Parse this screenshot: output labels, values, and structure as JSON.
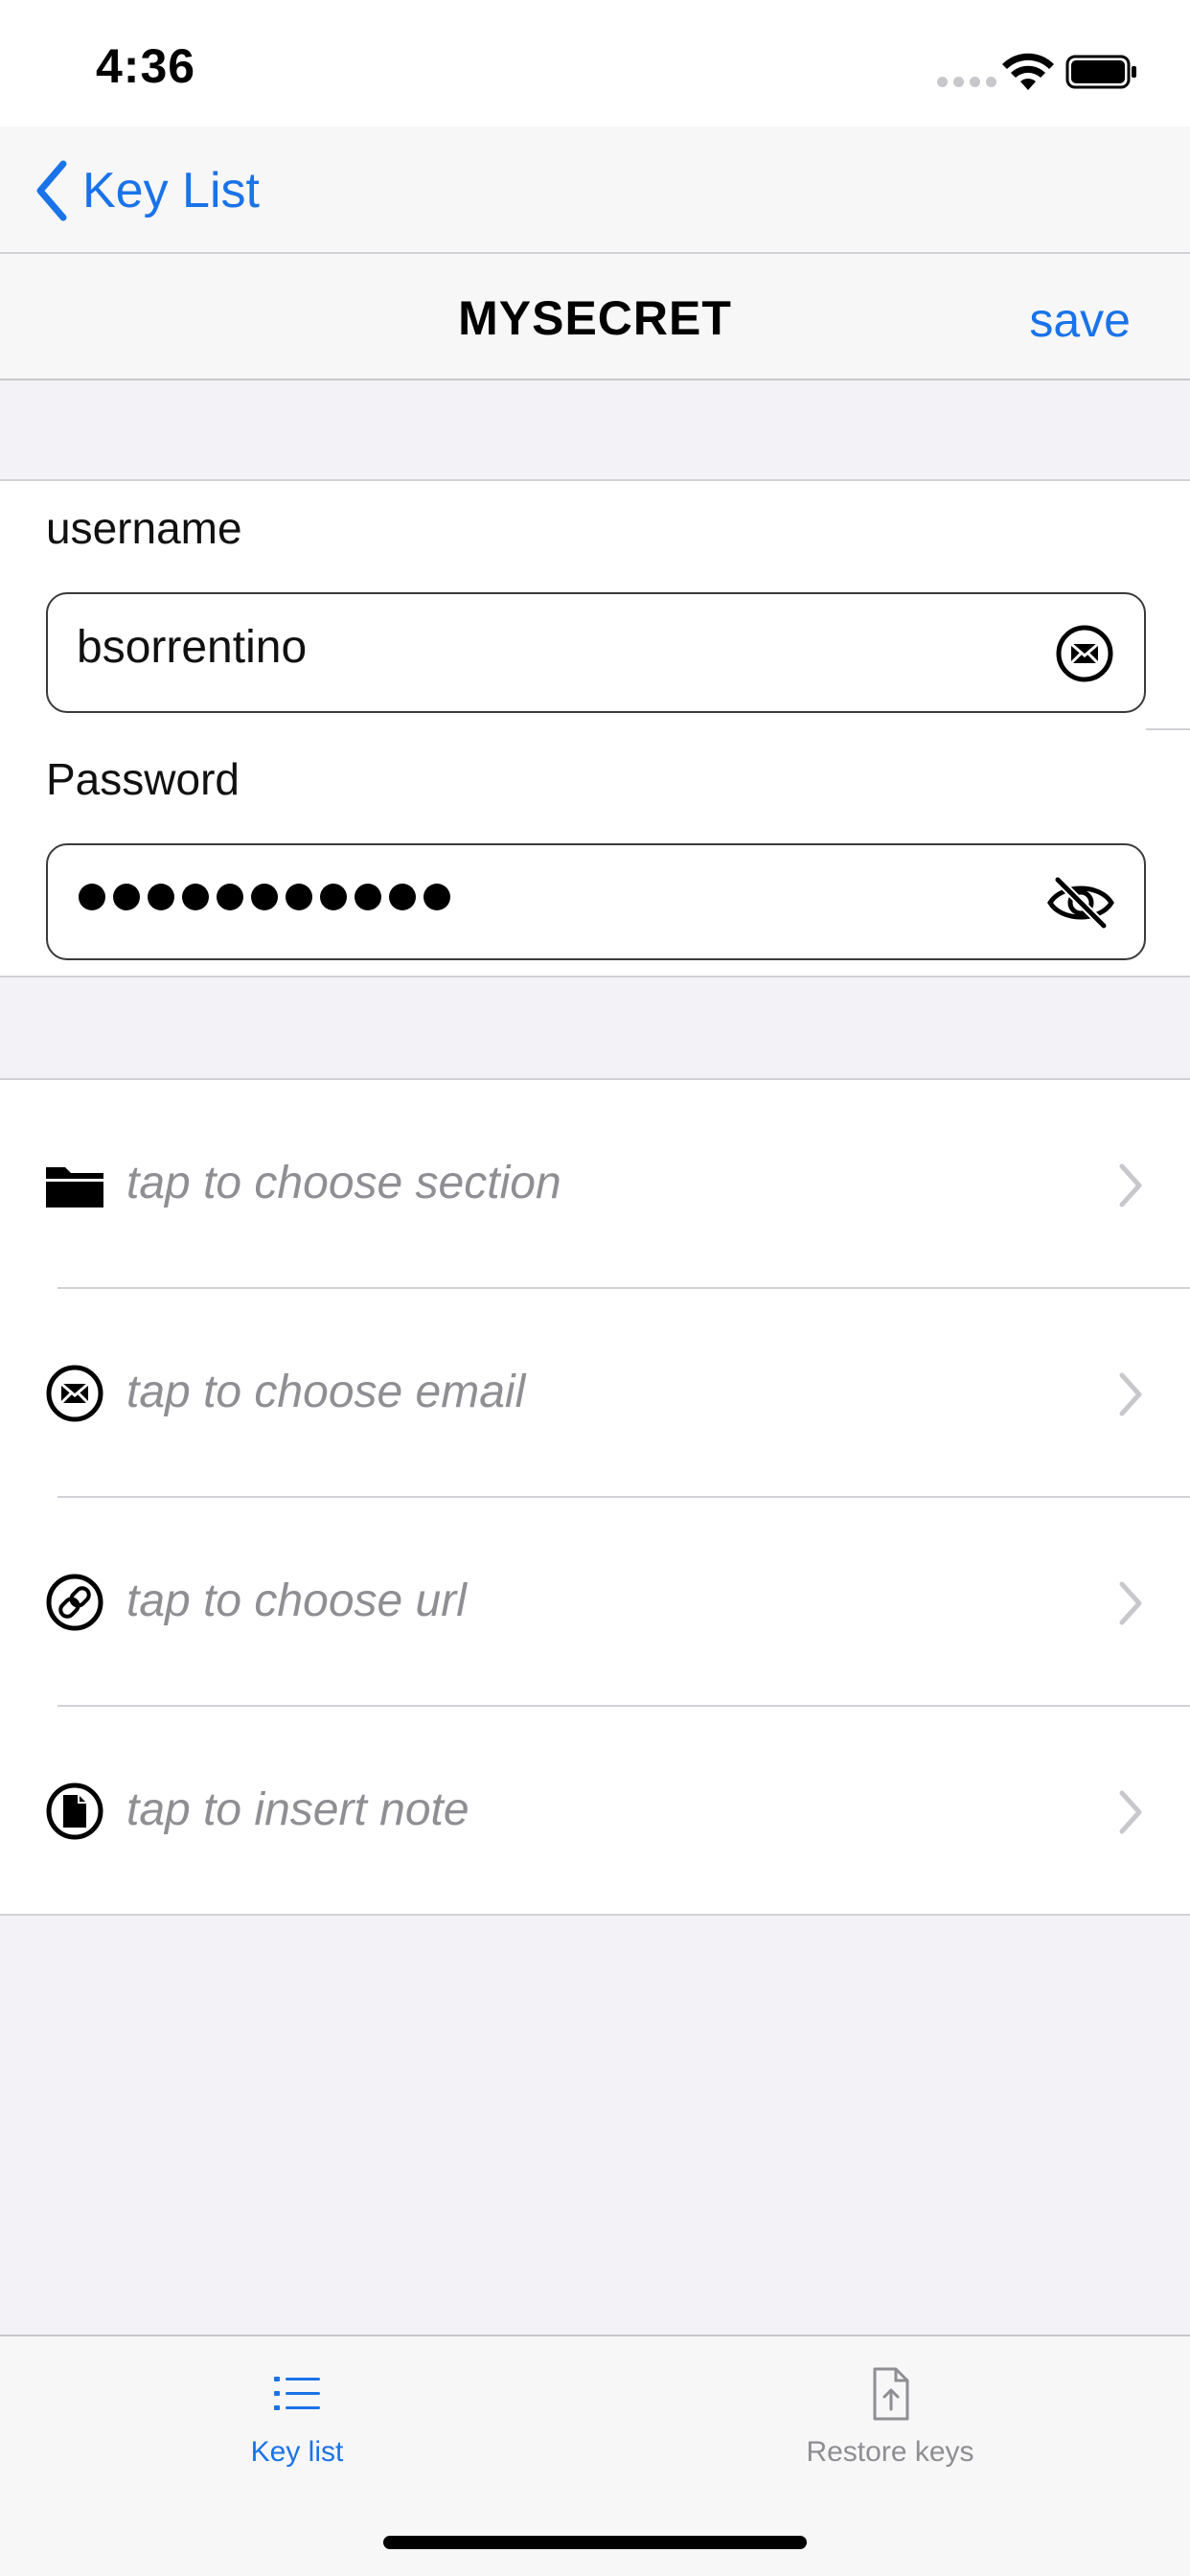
{
  "status_bar": {
    "time": "4:36"
  },
  "nav": {
    "back_label": "Key List"
  },
  "header": {
    "title": "MYSECRET",
    "save_label": "save"
  },
  "credentials": {
    "username_label": "username",
    "username_value": "bsorrentino",
    "password_label": "Password",
    "password_masked_count": 11
  },
  "options": [
    {
      "label": "tap to choose section",
      "icon": "folder-icon"
    },
    {
      "label": "tap to choose email",
      "icon": "email-icon"
    },
    {
      "label": "tap to choose url",
      "icon": "link-icon"
    },
    {
      "label": "tap to insert note",
      "icon": "note-icon"
    }
  ],
  "tabs": [
    {
      "label": "Key list",
      "icon": "list-icon",
      "active": true
    },
    {
      "label": "Restore keys",
      "icon": "file-upload-icon",
      "active": false
    }
  ],
  "colors": {
    "accent": "#1a73e8",
    "placeholder": "#8e8e93",
    "background": "#f2f2f7"
  }
}
